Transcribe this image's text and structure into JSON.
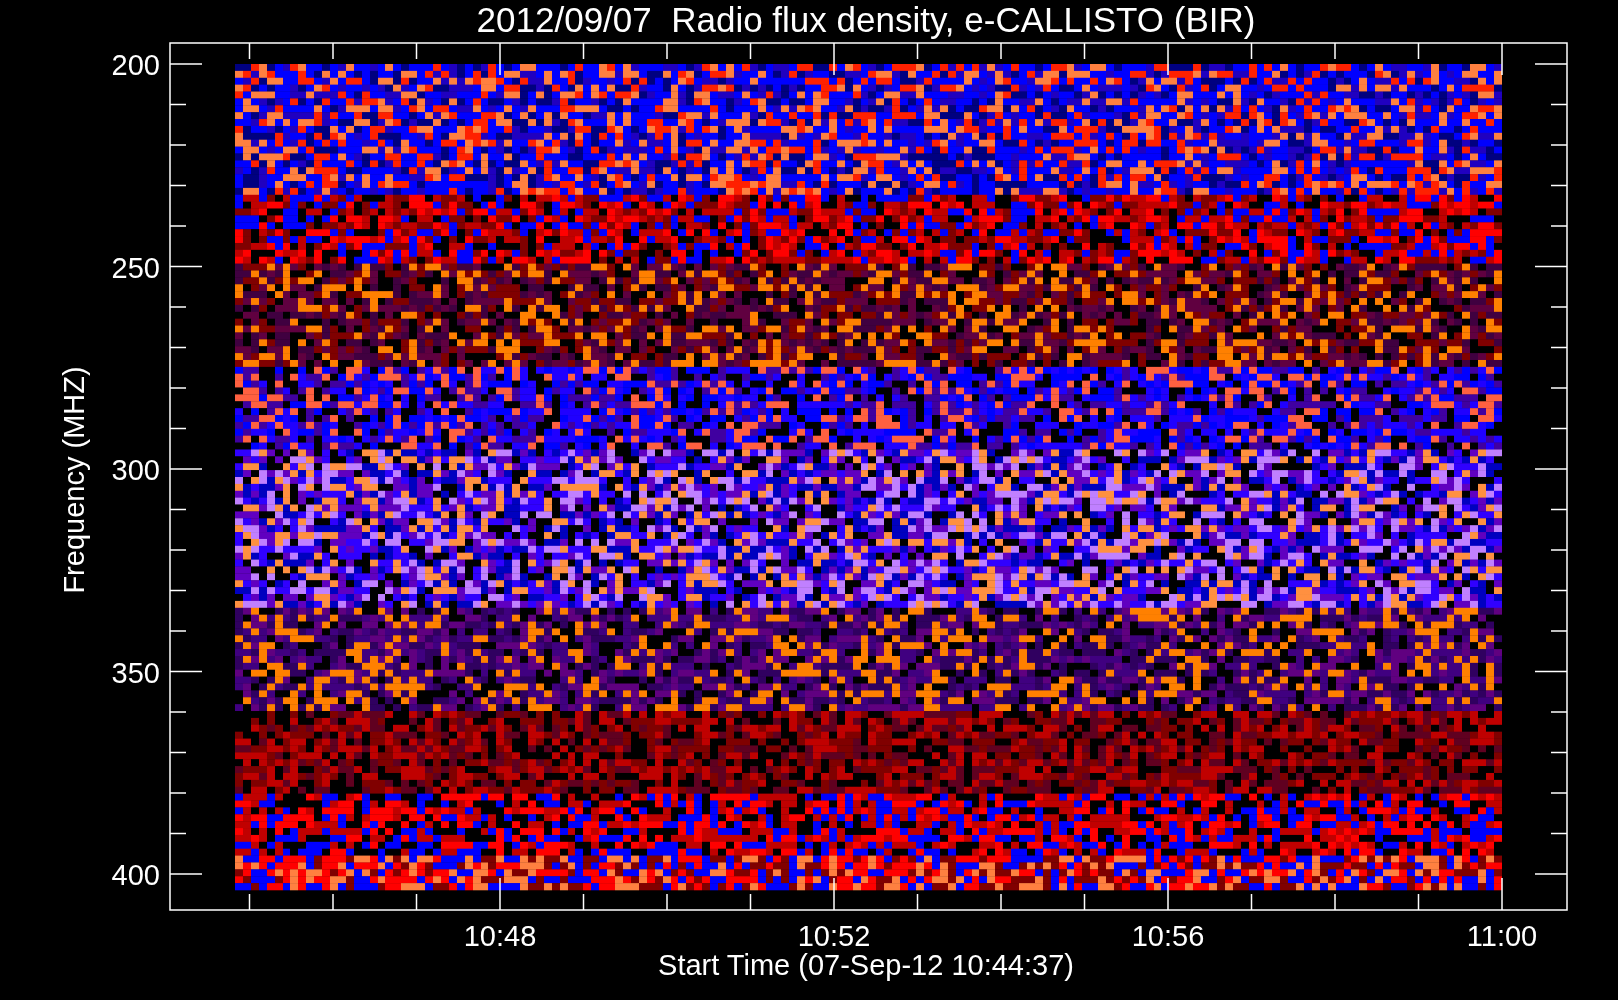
{
  "title": "2012/09/07  Radio flux density, e-CALLISTO (BIR)",
  "y_axis": {
    "label": "Frequency (MHZ)",
    "ticks": [
      "200",
      "250",
      "300",
      "350",
      "400"
    ]
  },
  "x_axis": {
    "label": "Start Time (07-Sep-12 10:44:37)",
    "ticks": [
      "10:48",
      "10:52",
      "10:56",
      "11:00"
    ]
  }
}
